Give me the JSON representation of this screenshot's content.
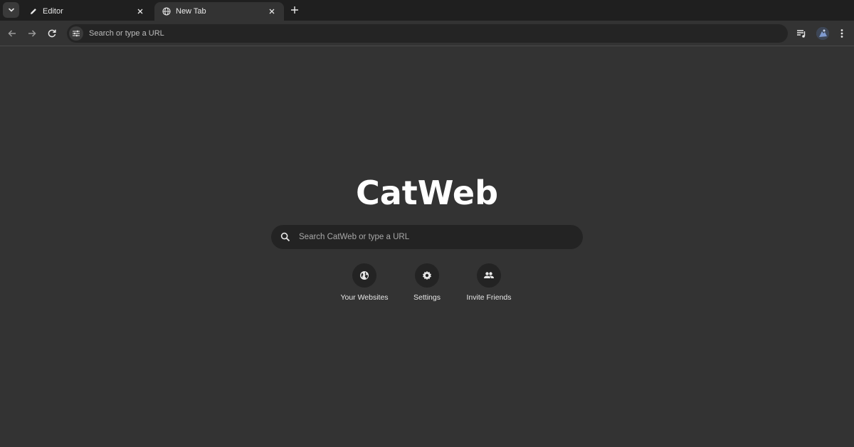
{
  "tabs": [
    {
      "title": "Editor",
      "icon": "pencil-icon",
      "active": false
    },
    {
      "title": "New Tab",
      "icon": "globe-icon",
      "active": true
    }
  ],
  "toolbar": {
    "omnibox_placeholder": "Search or type a URL"
  },
  "page": {
    "logo_text": "CatWeb",
    "search_placeholder": "Search CatWeb or type a URL",
    "shortcuts": [
      {
        "label": "Your Websites",
        "icon": "globe-icon"
      },
      {
        "label": "Settings",
        "icon": "gear-icon"
      },
      {
        "label": "Invite Friends",
        "icon": "people-icon"
      }
    ]
  },
  "colors": {
    "background": "#333333",
    "tabstrip": "#1f1f1f",
    "field": "#232323",
    "text": "#e8e8e8"
  }
}
